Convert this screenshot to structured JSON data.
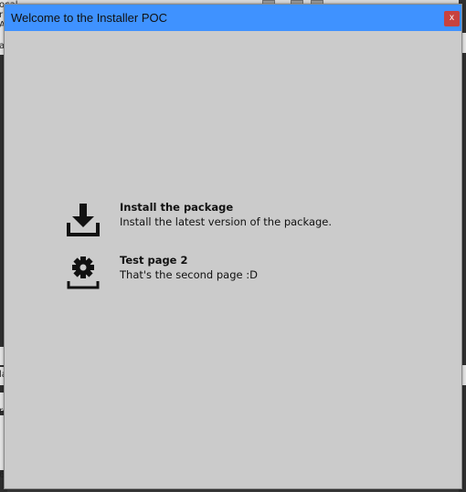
{
  "window": {
    "title": "Welcome to the Installer POC",
    "close_label": "x"
  },
  "background": {
    "left_edge_text": [
      "ocal",
      "ri",
      "A",
      "a",
      "la",
      "re",
      "6"
    ]
  },
  "items": [
    {
      "icon": "download-icon",
      "title": "Install the package",
      "description": "Install the latest version of the package."
    },
    {
      "icon": "gear-tray-icon",
      "title": "Test page 2",
      "description": "That's the second page :D"
    }
  ]
}
